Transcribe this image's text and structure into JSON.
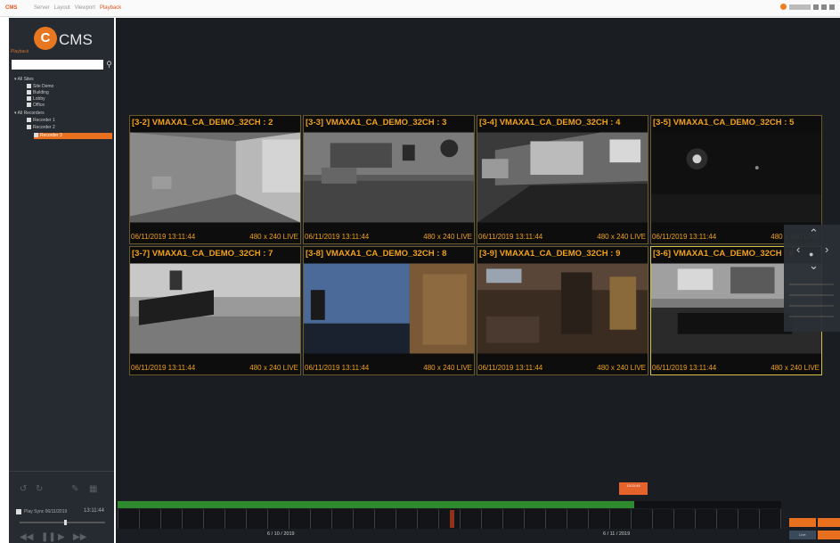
{
  "titlebar": {
    "brand": "CMS",
    "tabs": [
      "Server",
      "Layout",
      "Viewport",
      "Playback"
    ],
    "active_tab": 3
  },
  "sidebar": {
    "logo_letter": "C",
    "logo_text": "CMS",
    "panel_label": "Playback",
    "tree": [
      "All Sites",
      "Site Demo",
      "Building",
      "Lobby",
      "Office",
      "All Recorders",
      "Recorder 1",
      "Recorder 2",
      "Recorder 3"
    ],
    "playback_label": "Play Sync 06/11/2019",
    "playback_time": "13:11:44"
  },
  "cameras": [
    {
      "title": "[3-2] VMAXA1_CA_DEMO_32CH : 2",
      "time": "06/11/2019 13:11:44",
      "res": "480 x 240 LIVE",
      "scene": "room-white"
    },
    {
      "title": "[3-3] VMAXA1_CA_DEMO_32CH : 3",
      "time": "06/11/2019 13:11:44",
      "res": "480 x 240 LIVE",
      "scene": "office-gray"
    },
    {
      "title": "[3-4] VMAXA1_CA_DEMO_32CH : 4",
      "time": "06/11/2019 13:11:44",
      "res": "480 x 240 LIVE",
      "scene": "conference"
    },
    {
      "title": "[3-5] VMAXA1_CA_DEMO_32CH : 5",
      "time": "06/11/2019 13:11:44",
      "res": "480 x 240 LIVE",
      "scene": "dark"
    },
    {
      "title": "[3-7] VMAXA1_CA_DEMO_32CH : 7",
      "time": "06/11/2019 13:11:44",
      "res": "480 x 240 LIVE",
      "scene": "desk-room"
    },
    {
      "title": "[3-8] VMAXA1_CA_DEMO_32CH : 8",
      "time": "06/11/2019 13:11:44",
      "res": "480 x 240 LIVE",
      "scene": "hallway-blue"
    },
    {
      "title": "[3-9] VMAXA1_CA_DEMO_32CH : 9",
      "time": "06/11/2019 13:11:44",
      "res": "480 x 240 LIVE",
      "scene": "lobby-color"
    },
    {
      "title": "[3-6] VMAXA1_CA_DEMO_32CH : 6",
      "time": "06/11/2019 13:11:44",
      "res": "480 x 240 LIVE",
      "scene": "meeting"
    }
  ],
  "selected_camera": 7,
  "timeline": {
    "date_left": "6 / 10 / 2019",
    "date_right": "6 / 11 / 2019",
    "tooltip": "13:11:44",
    "cursor_label": "Live"
  },
  "colors": {
    "accent": "#e8701e",
    "overlay_text": "#f0a11a",
    "recording": "#2f8a2f"
  }
}
